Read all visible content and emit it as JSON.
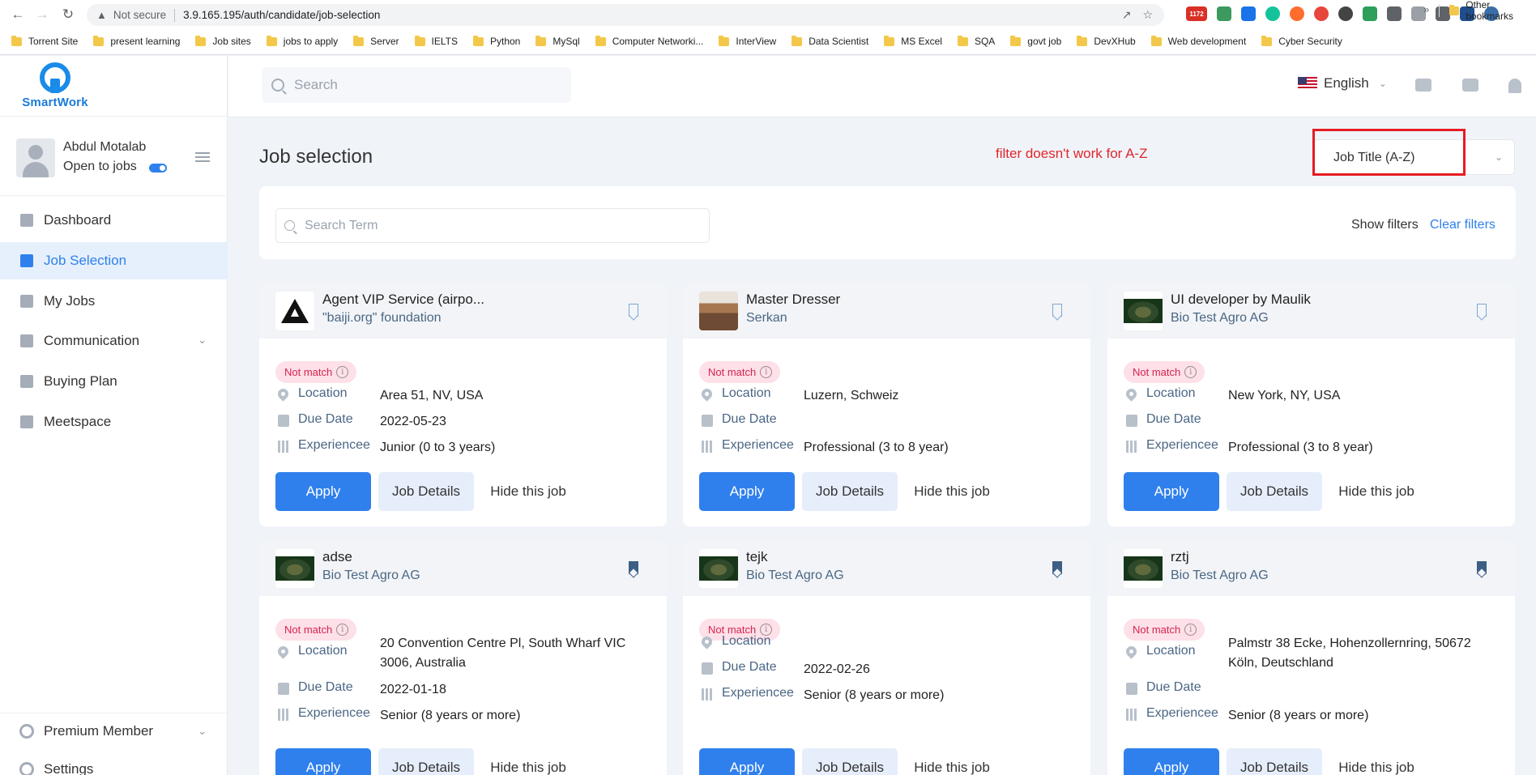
{
  "browser": {
    "security_label": "Not secure",
    "url": "3.9.165.195/auth/candidate/job-selection",
    "bookmarks": [
      "Torrent Site",
      "present learning",
      "Job sites",
      "jobs to apply",
      "Server",
      "IELTS",
      "Python",
      "MySql",
      "Computer Networki...",
      "InterView",
      "Data Scientist",
      "MS Excel",
      "SQA",
      "govt job",
      "DevXHub",
      "Web development",
      "Cyber Security"
    ],
    "bookmarks_more": "»",
    "other_bookmarks": "Other bookmarks",
    "extension_badge_count": "1172"
  },
  "sidebar": {
    "logo_text": "SmartWork",
    "profile": {
      "name": "Abdul Motalab",
      "status": "Open to jobs"
    },
    "nav": [
      {
        "label": "Dashboard",
        "icon": "dashboard-icon",
        "active": false
      },
      {
        "label": "Job Selection",
        "icon": "briefcase-icon",
        "active": true
      },
      {
        "label": "My Jobs",
        "icon": "bag-icon",
        "active": false
      },
      {
        "label": "Communication",
        "icon": "chat-icon",
        "active": false,
        "expandable": true
      },
      {
        "label": "Buying Plan",
        "icon": "cart-icon",
        "active": false
      },
      {
        "label": "Meetspace",
        "icon": "meet-icon",
        "active": false
      }
    ],
    "bottom": [
      {
        "label": "Premium Member",
        "icon": "premium-icon",
        "expandable": true
      },
      {
        "label": "Settings",
        "icon": "settings-icon"
      }
    ]
  },
  "header": {
    "search_placeholder": "Search",
    "language": "English"
  },
  "main": {
    "title": "Job selection",
    "annotation": "filter doesn't work for A-Z",
    "sort_value": "Job Title (A-Z)",
    "term_placeholder": "Search Term",
    "show_filters": "Show filters",
    "clear_filters": "Clear filters",
    "labels": {
      "location": "Location",
      "due_date": "Due Date",
      "experience": "Experiencee"
    },
    "buttons": {
      "apply": "Apply",
      "details": "Job Details",
      "hide": "Hide this job"
    },
    "match_badge": "Not match",
    "info_glyph": "i"
  },
  "jobs": [
    {
      "title": "Agent VIP Service (airpo...",
      "company": "\"baiji.org\" foundation",
      "location": "Area 51, NV, USA",
      "due_date": "2022-05-23",
      "experience": "Junior (0 to 3 years)",
      "bookmarked": false,
      "logo": "triangle-logo"
    },
    {
      "title": "Master Dresser",
      "company": "Serkan",
      "location": "Luzern, Schweiz",
      "due_date": "",
      "experience": "Professional (3 to 8 year)",
      "bookmarked": false,
      "logo": "dresser-logo"
    },
    {
      "title": "UI developer by Maulik",
      "company": "Bio Test Agro AG",
      "location": "New York, NY, USA",
      "due_date": "",
      "experience": "Professional (3 to 8 year)",
      "bookmarked": false,
      "logo": "turtle-logo"
    },
    {
      "title": "adse",
      "company": "Bio Test Agro AG",
      "location": "20 Convention Centre Pl, South Wharf VIC 3006, Australia",
      "due_date": "2022-01-18",
      "experience": "Senior (8 years or more)",
      "bookmarked": true,
      "logo": "turtle-logo"
    },
    {
      "title": "tejk",
      "company": "Bio Test Agro AG",
      "location": "",
      "due_date": "2022-02-26",
      "experience": "Senior (8 years or more)",
      "bookmarked": true,
      "logo": "turtle-logo"
    },
    {
      "title": "rztj",
      "company": "Bio Test Agro AG",
      "location": "Palmstr 38 Ecke, Hohenzollernring, 50672 Köln, Deutschland",
      "due_date": "",
      "experience": "Senior (8 years or more)",
      "bookmarked": true,
      "logo": "turtle-logo"
    }
  ],
  "colors": {
    "accent": "#2f80ed",
    "badge_bg": "#fde0e8",
    "badge_text": "#d6244f",
    "annotation": "#e0262b"
  }
}
